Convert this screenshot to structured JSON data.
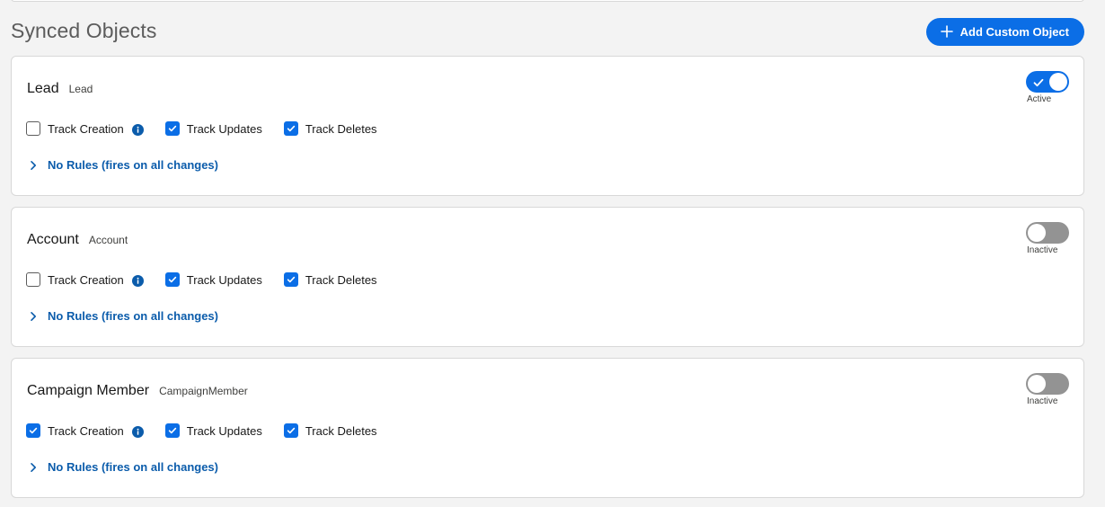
{
  "header": {
    "title": "Synced Objects",
    "add_button_label": "Add Custom Object"
  },
  "colors": {
    "accent": "#0b6ee6",
    "link": "#0b5cab",
    "toggle_off": "#939393"
  },
  "objects": [
    {
      "label": "Lead",
      "api_name": "Lead",
      "active": true,
      "status_label": "Active",
      "track_creation": {
        "label": "Track Creation",
        "checked": false
      },
      "track_updates": {
        "label": "Track Updates",
        "checked": true
      },
      "track_deletes": {
        "label": "Track Deletes",
        "checked": true
      },
      "rules_label": "No Rules (fires on all changes)"
    },
    {
      "label": "Account",
      "api_name": "Account",
      "active": false,
      "status_label": "Inactive",
      "track_creation": {
        "label": "Track Creation",
        "checked": false
      },
      "track_updates": {
        "label": "Track Updates",
        "checked": true
      },
      "track_deletes": {
        "label": "Track Deletes",
        "checked": true
      },
      "rules_label": "No Rules (fires on all changes)"
    },
    {
      "label": "Campaign Member",
      "api_name": "CampaignMember",
      "active": false,
      "status_label": "Inactive",
      "track_creation": {
        "label": "Track Creation",
        "checked": true
      },
      "track_updates": {
        "label": "Track Updates",
        "checked": true
      },
      "track_deletes": {
        "label": "Track Deletes",
        "checked": true
      },
      "rules_label": "No Rules (fires on all changes)"
    }
  ]
}
